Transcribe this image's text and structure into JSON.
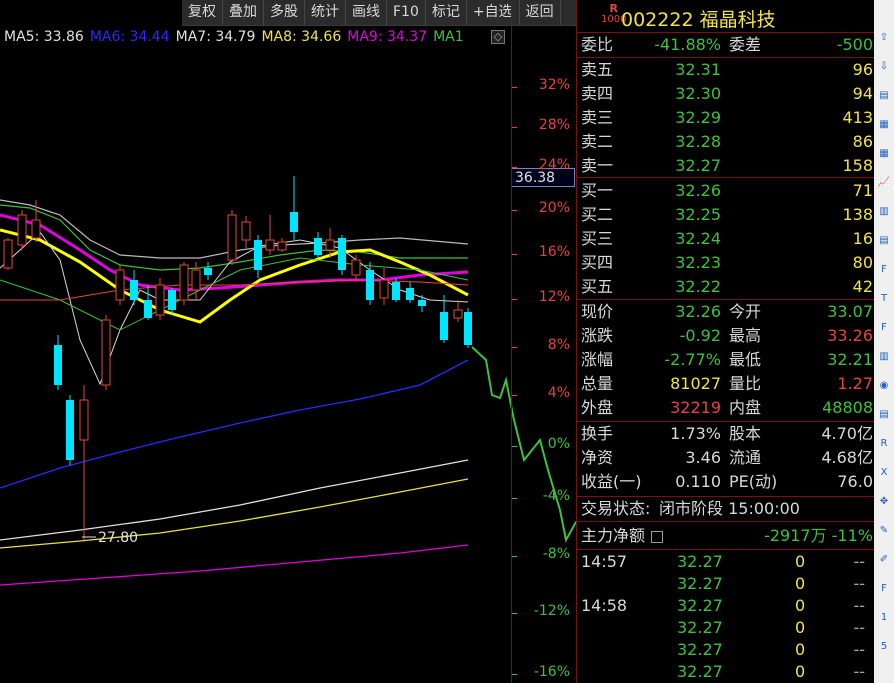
{
  "toolbar": {
    "items": [
      "复权",
      "叠加",
      "多股",
      "统计",
      "画线",
      "F10",
      "标记",
      "+自选",
      "返回"
    ]
  },
  "ma_legend": [
    {
      "label": "MA5: 33.86",
      "color": "#e0e0e0"
    },
    {
      "label": "MA6: 34.44",
      "color": "#2a2aff"
    },
    {
      "label": "MA7: 34.79",
      "color": "#e0e0e0"
    },
    {
      "label": "MA8: 34.66",
      "color": "#f2e24a"
    },
    {
      "label": "MA9: 34.37",
      "color": "#e000e0"
    },
    {
      "label": "MA1",
      "color": "#3cc23c"
    }
  ],
  "price_scale": {
    "current_price_tag": "36.38",
    "ticks": [
      "32%",
      "28%",
      "24%",
      "20%",
      "16%",
      "12%",
      "8%",
      "4%",
      "0%",
      "-4%",
      "-8%",
      "-12%",
      "-16%"
    ],
    "low_label": "27.80"
  },
  "stock": {
    "badge_top": "R",
    "badge_bottom": "1000",
    "code_name": "002222 福晶科技"
  },
  "weibi": {
    "label": "委比",
    "value": "-41.88%",
    "label2": "委差",
    "value2": "-500"
  },
  "asks": [
    {
      "label": "卖五",
      "price": "32.31",
      "vol": "96"
    },
    {
      "label": "卖四",
      "price": "32.30",
      "vol": "94"
    },
    {
      "label": "卖三",
      "price": "32.29",
      "vol": "413"
    },
    {
      "label": "卖二",
      "price": "32.28",
      "vol": "86"
    },
    {
      "label": "卖一",
      "price": "32.27",
      "vol": "158"
    }
  ],
  "bids": [
    {
      "label": "买一",
      "price": "32.26",
      "vol": "71"
    },
    {
      "label": "买二",
      "price": "32.25",
      "vol": "138"
    },
    {
      "label": "买三",
      "price": "32.24",
      "vol": "16"
    },
    {
      "label": "买四",
      "price": "32.23",
      "vol": "80"
    },
    {
      "label": "买五",
      "price": "32.22",
      "vol": "42"
    }
  ],
  "quote": [
    {
      "l1": "现价",
      "v1": "32.26",
      "c1": "g",
      "l2": "今开",
      "v2": "33.07",
      "c2": "g"
    },
    {
      "l1": "涨跌",
      "v1": "-0.92",
      "c1": "g",
      "l2": "最高",
      "v2": "33.26",
      "c2": "r"
    },
    {
      "l1": "涨幅",
      "v1": "-2.77%",
      "c1": "g",
      "l2": "最低",
      "v2": "32.21",
      "c2": "g"
    },
    {
      "l1": "总量",
      "v1": "81027",
      "c1": "y",
      "l2": "量比",
      "v2": "1.27",
      "c2": "r"
    },
    {
      "l1": "外盘",
      "v1": "32219",
      "c1": "r",
      "l2": "内盘",
      "v2": "48808",
      "c2": "g"
    }
  ],
  "fundamentals": [
    {
      "l1": "换手",
      "v1": "1.73%",
      "l2": "股本",
      "v2": "4.70亿"
    },
    {
      "l1": "净资",
      "v1": "3.46",
      "l2": "流通",
      "v2": "4.68亿"
    },
    {
      "l1": "收益(一)",
      "v1": "0.110",
      "l2": "PE(动)",
      "v2": "76.0"
    }
  ],
  "status": {
    "label": "交易状态:",
    "value": "闭市阶段 15:00:00"
  },
  "main_flow": {
    "label": "主力净额",
    "value": "-2917万 -11%"
  },
  "ticks": [
    {
      "time": "14:57",
      "price": "32.27",
      "vol": "0",
      "dir": "--"
    },
    {
      "time": "",
      "price": "32.27",
      "vol": "0",
      "dir": "--"
    },
    {
      "time": "14:58",
      "price": "32.27",
      "vol": "0",
      "dir": "--"
    },
    {
      "time": "",
      "price": "32.27",
      "vol": "0",
      "dir": "--"
    },
    {
      "time": "",
      "price": "32.27",
      "vol": "0",
      "dir": "--"
    },
    {
      "time": "",
      "price": "32.27",
      "vol": "0",
      "dir": "--"
    }
  ],
  "side_icons": [
    "up-arrow-icon",
    "down-arrow-icon",
    "chart-icon",
    "grid-icon",
    "grid-icon-2",
    "trend-icon",
    "candle-icon",
    "list-icon",
    "f10-icon",
    "text-icon",
    "f2-icon",
    "kline-icon",
    "circle-icon",
    "bar-icon",
    "rs-icon",
    "excel-icon",
    "move-icon",
    "pencil-icon",
    "pen-icon",
    "fs-icon",
    "num-1",
    "num-5"
  ],
  "colors": {
    "up": "#e8433a",
    "down": "#3cc23c",
    "ma_yellow": "#ffff00",
    "ma_magenta": "#e000e0",
    "bg": "#000000"
  }
}
